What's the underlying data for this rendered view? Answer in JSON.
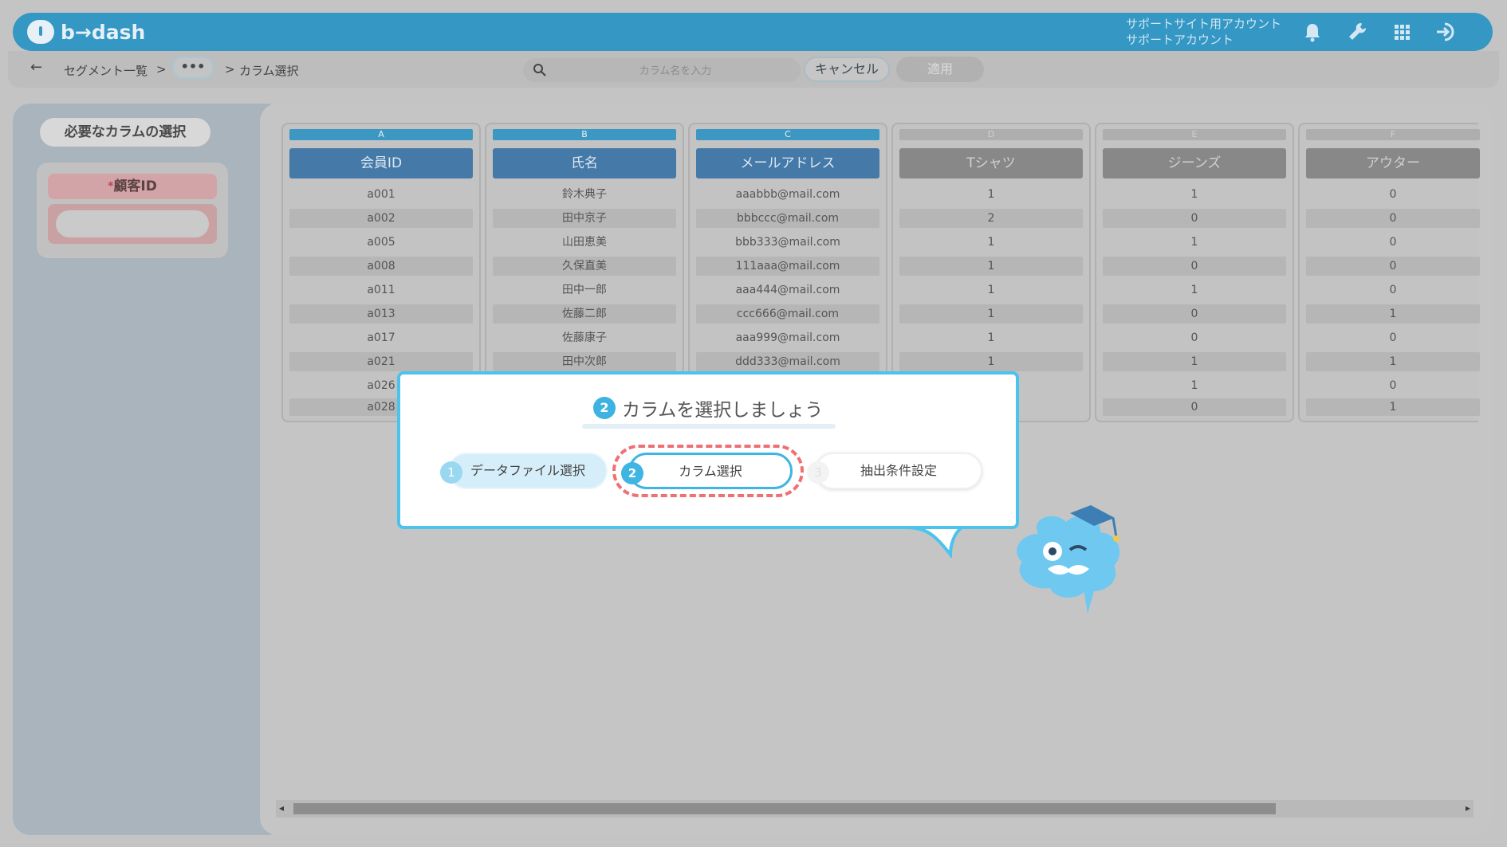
{
  "header": {
    "logo_text": "b→dash",
    "account_line1": "サポートサイト用アカウント",
    "account_line2": "サポートアカウント",
    "icons": [
      "bell-icon",
      "wrench-icon",
      "apps-grid-icon",
      "logout-icon"
    ]
  },
  "toolbar": {
    "back_icon": "arrow-left-icon",
    "back_glyph": "←",
    "crumb_segment": "セグメント一覧",
    "crumb_sep1": ">",
    "more_label": "•••",
    "crumb_sep2": ">",
    "crumb_current": "カラム選択",
    "search_placeholder": "カラム名を入力",
    "cancel_label": "キャンセル",
    "apply_label": "適用"
  },
  "left_panel": {
    "tab_label": "必要なカラムの選択",
    "required_star": "*",
    "required_label": "顧客ID"
  },
  "columns": [
    {
      "letter": "A",
      "header": "会員ID",
      "selected": true,
      "cells": [
        "a001",
        "a002",
        "a005",
        "a008",
        "a011",
        "a013",
        "a017",
        "a021",
        "a026",
        "a028"
      ]
    },
    {
      "letter": "B",
      "header": "氏名",
      "selected": true,
      "cells": [
        "鈴木典子",
        "田中京子",
        "山田恵美",
        "久保直美",
        "田中一郎",
        "佐藤二郎",
        "佐藤康子",
        "田中次郎",
        "",
        ""
      ]
    },
    {
      "letter": "C",
      "header": "メールアドレス",
      "selected": true,
      "cells": [
        "aaabbb@mail.com",
        "bbbccc@mail.com",
        "bbb333@mail.com",
        "111aaa@mail.com",
        "aaa444@mail.com",
        "ccc666@mail.com",
        "aaa999@mail.com",
        "ddd333@mail.com",
        "",
        ""
      ]
    },
    {
      "letter": "D",
      "header": "Tシャツ",
      "selected": false,
      "cells": [
        "1",
        "2",
        "1",
        "1",
        "1",
        "1",
        "1",
        "1",
        "",
        ""
      ]
    },
    {
      "letter": "E",
      "header": "ジーンズ",
      "selected": false,
      "cells": [
        "1",
        "0",
        "1",
        "0",
        "1",
        "0",
        "0",
        "1",
        "1",
        "0"
      ]
    },
    {
      "letter": "F",
      "header": "アウター",
      "selected": false,
      "cells": [
        "0",
        "0",
        "0",
        "0",
        "0",
        "1",
        "0",
        "1",
        "0",
        "1"
      ]
    }
  ],
  "tutorial": {
    "title_number": "2",
    "title": "カラムを選択しましょう",
    "steps": [
      {
        "number": "1",
        "label": "データファイル選択",
        "state": "done"
      },
      {
        "number": "2",
        "label": "カラム選択",
        "state": "current"
      },
      {
        "number": "3",
        "label": "抽出条件設定",
        "state": "todo"
      }
    ]
  },
  "colors": {
    "brand": "#3497c4",
    "selected_header": "#4479a8",
    "tutorial_accent": "#4cc3ec",
    "highlight_ring": "#ef7074"
  }
}
